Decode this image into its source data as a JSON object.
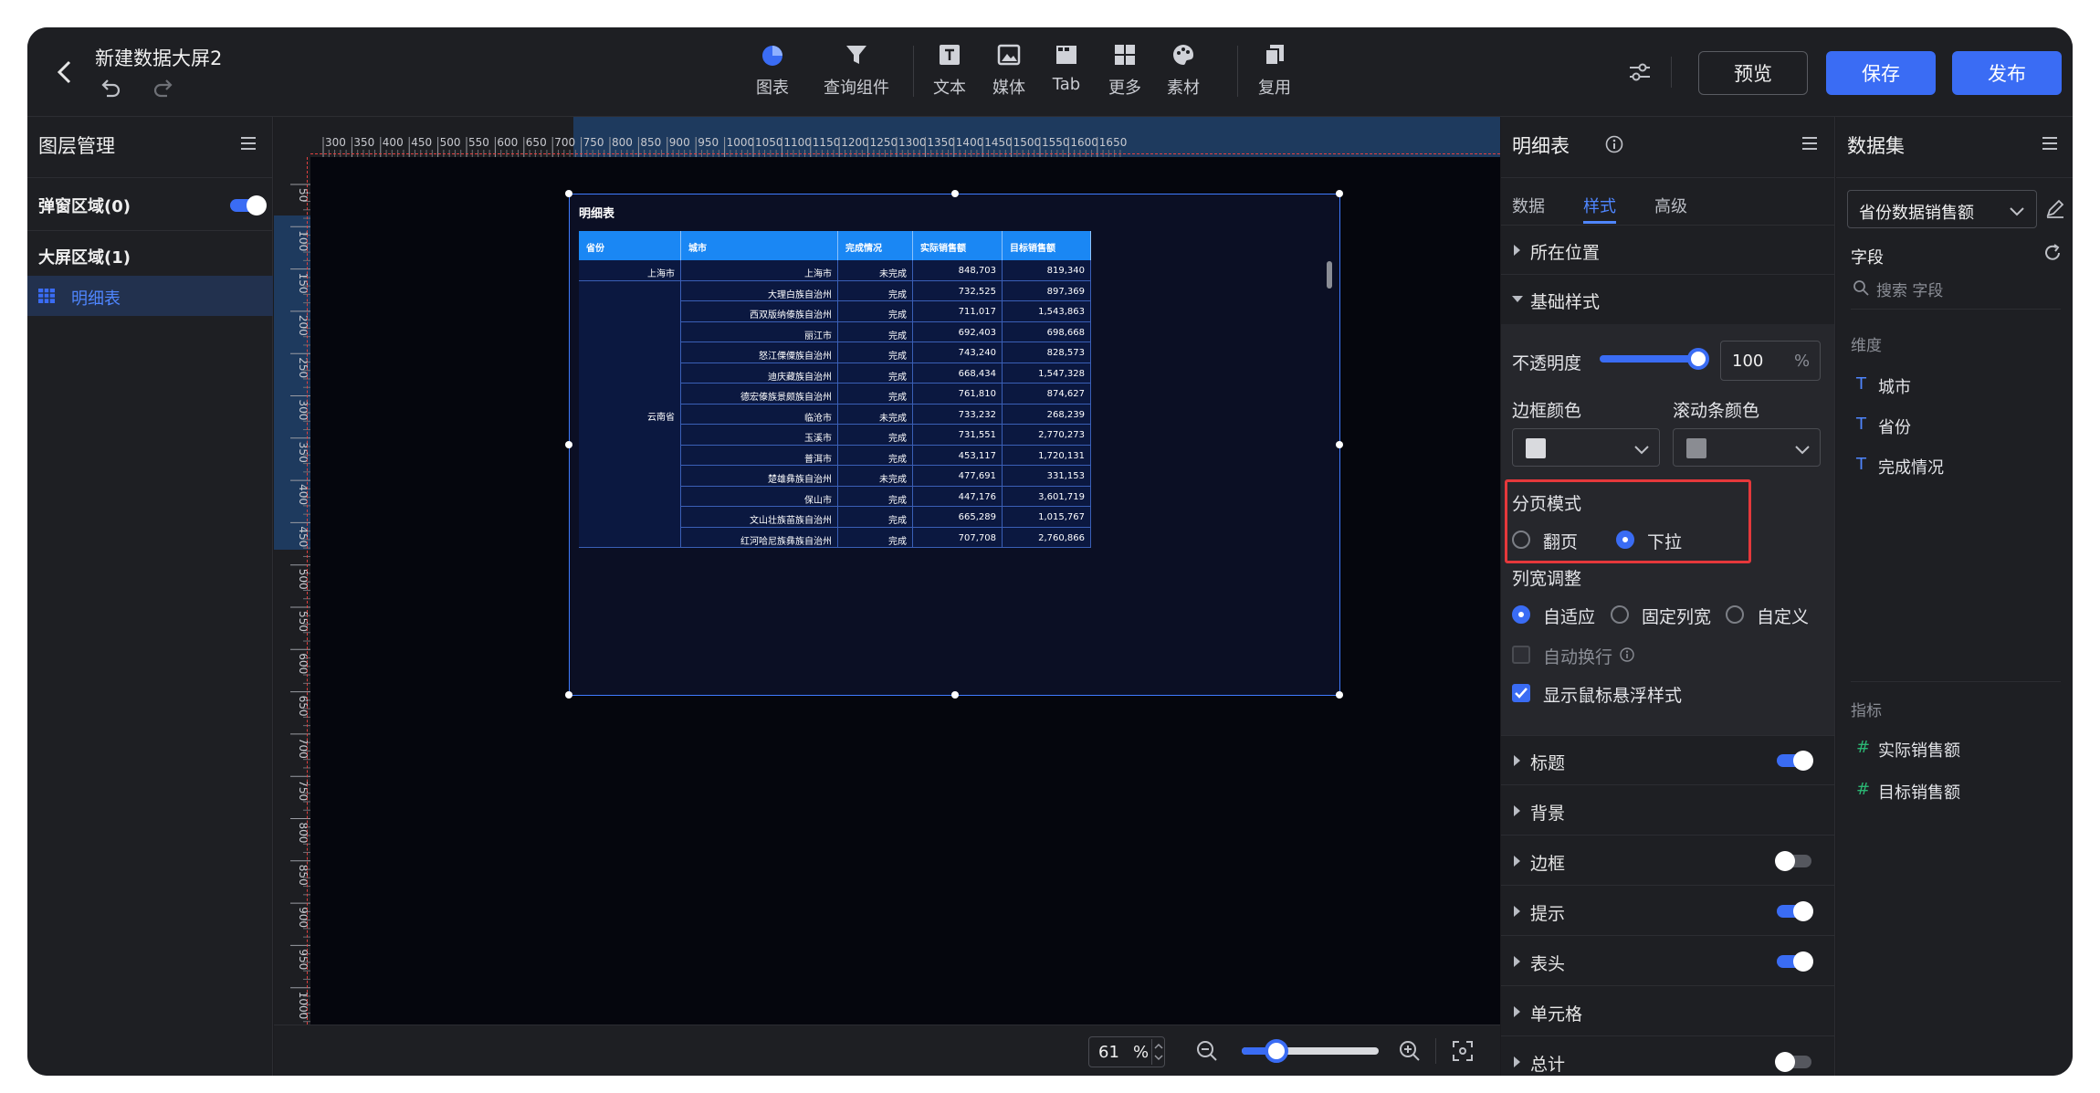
{
  "header": {
    "title": "新建数据大屏2",
    "tools": [
      {
        "label": "图表",
        "icon": "pie-chart-icon"
      },
      {
        "label": "查询组件",
        "icon": "filter-icon"
      },
      {
        "label": "文本",
        "icon": "text-icon"
      },
      {
        "label": "媒体",
        "icon": "image-icon"
      },
      {
        "label": "Tab",
        "icon": "tab-icon"
      },
      {
        "label": "更多",
        "icon": "grid-icon"
      },
      {
        "label": "素材",
        "icon": "palette-icon"
      },
      {
        "label": "复用",
        "icon": "copy-icon"
      }
    ],
    "preview_label": "预览",
    "save_label": "保存",
    "publish_label": "发布",
    "accent": "#3a6cf4"
  },
  "layers": {
    "title": "图层管理",
    "popup_area": "弹窗区域(0)",
    "screen_area": "大屏区域(1)",
    "items": [
      {
        "label": "明细表",
        "icon": "table-icon"
      }
    ]
  },
  "canvas": {
    "ruler_h": [
      "300",
      "350",
      "400",
      "450",
      "500",
      "550",
      "600",
      "650",
      "700",
      "750",
      "800",
      "850",
      "900",
      "950",
      "1000",
      "1050",
      "1100",
      "1150",
      "1200",
      "1250",
      "1300",
      "1350",
      "1400",
      "1450",
      "1500",
      "1550",
      "1600",
      "1650"
    ],
    "ruler_v": [
      "50",
      "100",
      "150",
      "200",
      "250",
      "300",
      "350",
      "400",
      "450",
      "500",
      "550",
      "600",
      "650",
      "700",
      "750",
      "800",
      "850",
      "900",
      "950",
      "1000"
    ],
    "zoom": "61",
    "zoom_unit": "%",
    "zoom_level": 0.25
  },
  "widget": {
    "title": "明细表",
    "columns": [
      "省份",
      "城市",
      "完成情况",
      "实际销售额",
      "目标销售额"
    ],
    "rows": [
      {
        "province": "上海市",
        "city": "上海市",
        "status": "未完成",
        "actual": "848,703",
        "target": "819,340"
      },
      {
        "province": "",
        "city": "大理白族自治州",
        "status": "完成",
        "actual": "732,525",
        "target": "897,369"
      },
      {
        "province": "",
        "city": "西双版纳傣族自治州",
        "status": "完成",
        "actual": "711,017",
        "target": "1,543,863"
      },
      {
        "province": "",
        "city": "丽江市",
        "status": "完成",
        "actual": "692,403",
        "target": "698,668"
      },
      {
        "province": "",
        "city": "怒江傈僳族自治州",
        "status": "完成",
        "actual": "743,240",
        "target": "828,573"
      },
      {
        "province": "",
        "city": "迪庆藏族自治州",
        "status": "完成",
        "actual": "668,434",
        "target": "1,547,328"
      },
      {
        "province": "",
        "city": "德宏傣族景颇族自治州",
        "status": "完成",
        "actual": "761,810",
        "target": "874,627"
      },
      {
        "province": "",
        "city": "临沧市",
        "status": "未完成",
        "actual": "733,232",
        "target": "268,239"
      },
      {
        "province": "云南省",
        "city": "玉溪市",
        "status": "完成",
        "actual": "731,551",
        "target": "2,770,273"
      },
      {
        "province": "",
        "city": "普洱市",
        "status": "完成",
        "actual": "453,117",
        "target": "1,720,131"
      },
      {
        "province": "",
        "city": "楚雄彝族自治州",
        "status": "未完成",
        "actual": "477,691",
        "target": "331,153"
      },
      {
        "province": "",
        "city": "保山市",
        "status": "完成",
        "actual": "447,176",
        "target": "3,601,719"
      },
      {
        "province": "",
        "city": "文山壮族苗族自治州",
        "status": "完成",
        "actual": "665,289",
        "target": "1,015,767"
      },
      {
        "province": "",
        "city": "红河哈尼族彝族自治州",
        "status": "完成",
        "actual": "707,708",
        "target": "2,760,866"
      }
    ]
  },
  "props": {
    "title": "明细表",
    "tabs": [
      "数据",
      "样式",
      "高级"
    ],
    "active_tab": "样式",
    "position_section": "所在位置",
    "basic_section": "基础样式",
    "opacity_label": "不透明度",
    "opacity_value": "100",
    "opacity_unit": "%",
    "border_color_label": "边框颜色",
    "scroll_color_label": "滚动条颜色",
    "paging_label": "分页模式",
    "paging_options": [
      "翻页",
      "下拉"
    ],
    "paging_selected": "下拉",
    "colwidth_label": "列宽调整",
    "colwidth_options": [
      "自适应",
      "固定列宽",
      "自定义"
    ],
    "colwidth_selected": "自适应",
    "wrap_label": "自动换行",
    "hover_label": "显示鼠标悬浮样式",
    "sections": [
      {
        "label": "标题",
        "toggle": true
      },
      {
        "label": "背景",
        "toggle": null
      },
      {
        "label": "边框",
        "toggle": false
      },
      {
        "label": "提示",
        "toggle": true
      },
      {
        "label": "表头",
        "toggle": true
      },
      {
        "label": "单元格",
        "toggle": null
      },
      {
        "label": "总计",
        "toggle": false
      }
    ]
  },
  "dataset": {
    "title": "数据集",
    "selected": "省份数据销售额",
    "fields_label": "字段",
    "search_placeholder": "搜索 字段",
    "dimensions_label": "维度",
    "dimensions": [
      "城市",
      "省份",
      "完成情况"
    ],
    "measures_label": "指标",
    "measures": [
      "实际销售额",
      "目标销售额"
    ]
  }
}
